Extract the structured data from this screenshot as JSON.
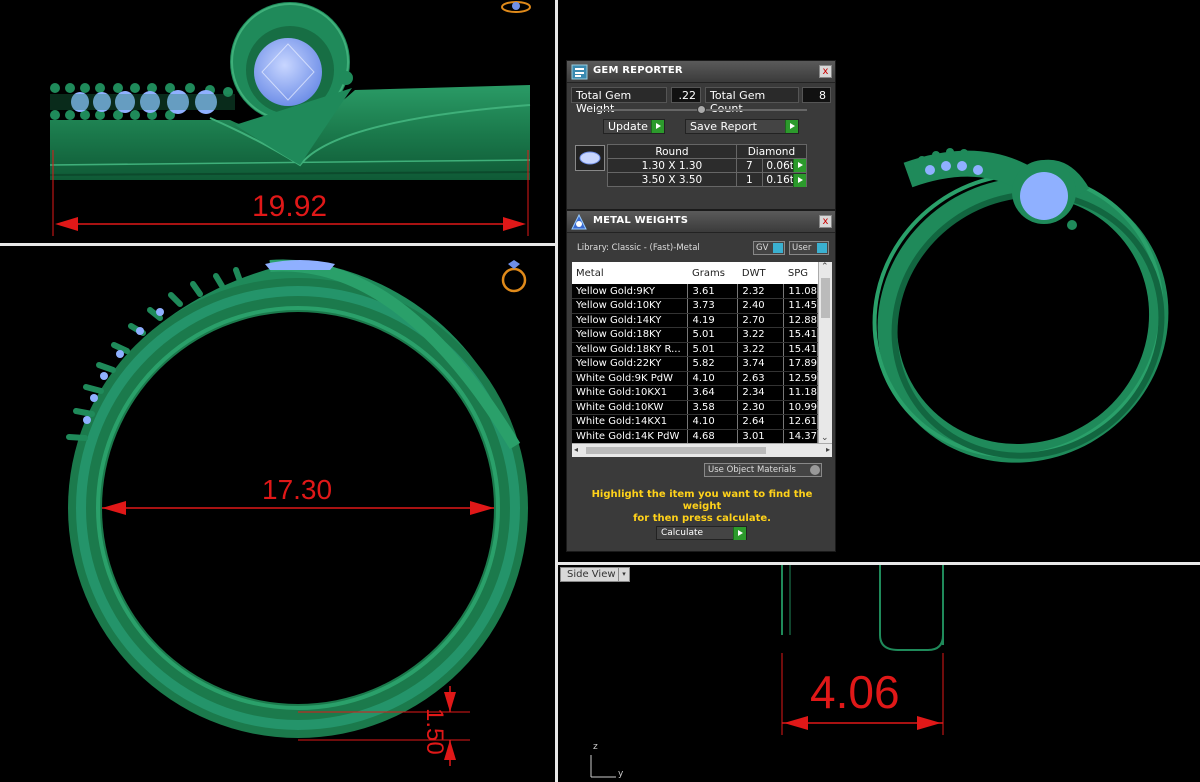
{
  "viewports": {
    "top_left": {
      "dimension": "19.92"
    },
    "bottom_left": {
      "dimension": "17.30",
      "thickness": "1.50"
    },
    "bottom_right": {
      "label": "Side View",
      "dimension": "4.06",
      "axis_z": "z",
      "axis_y": "y"
    }
  },
  "gem_reporter": {
    "title": "GEM REPORTER",
    "close": "x",
    "total_weight_label": "Total Gem Weight",
    "total_weight_value": ".22",
    "total_count_label": "Total Gem Count",
    "total_count_value": "8",
    "update_label": "Update",
    "save_report_label": "Save Report",
    "table_headers": [
      "Round",
      "Diamond"
    ],
    "rows": [
      {
        "size": "1.30 X 1.30",
        "count": "7",
        "weight": "0.06tw"
      },
      {
        "size": "3.50 X 3.50",
        "count": "1",
        "weight": "0.16tw"
      }
    ]
  },
  "metal_weights": {
    "title": "METAL WEIGHTS",
    "close": "x",
    "library": "Library: Classic - (Fast)-Metal",
    "gv_label": "GV",
    "user_label": "User",
    "columns": [
      "Metal",
      "Grams",
      "DWT",
      "SPG"
    ],
    "rows": [
      [
        "Yellow Gold:9KY",
        "3.61",
        "2.32",
        "11.08"
      ],
      [
        "Yellow Gold:10KY",
        "3.73",
        "2.40",
        "11.45"
      ],
      [
        "Yellow Gold:14KY",
        "4.19",
        "2.70",
        "12.88"
      ],
      [
        "Yellow Gold:18KY",
        "5.01",
        "3.22",
        "15.41"
      ],
      [
        "Yellow Gold:18KY R...",
        "5.01",
        "3.22",
        "15.41"
      ],
      [
        "Yellow Gold:22KY",
        "5.82",
        "3.74",
        "17.89"
      ],
      [
        "White Gold:9K PdW",
        "4.10",
        "2.63",
        "12.59"
      ],
      [
        "White Gold:10KX1",
        "3.64",
        "2.34",
        "11.18"
      ],
      [
        "White Gold:10KW",
        "3.58",
        "2.30",
        "10.99"
      ],
      [
        "White Gold:14KX1",
        "4.10",
        "2.64",
        "12.61"
      ],
      [
        "White Gold:14K PdW",
        "4.68",
        "3.01",
        "14.37"
      ]
    ],
    "use_object_materials": "Use Object Materials",
    "hint_line1": "Highlight the item you want to find the weight",
    "hint_line2": "for then press calculate.",
    "calculate_label": "Calculate"
  },
  "colors": {
    "metal": "#1f8a5a",
    "gem": "#8fb0ff",
    "dimension": "#e01818",
    "hint": "#ffd21a"
  }
}
